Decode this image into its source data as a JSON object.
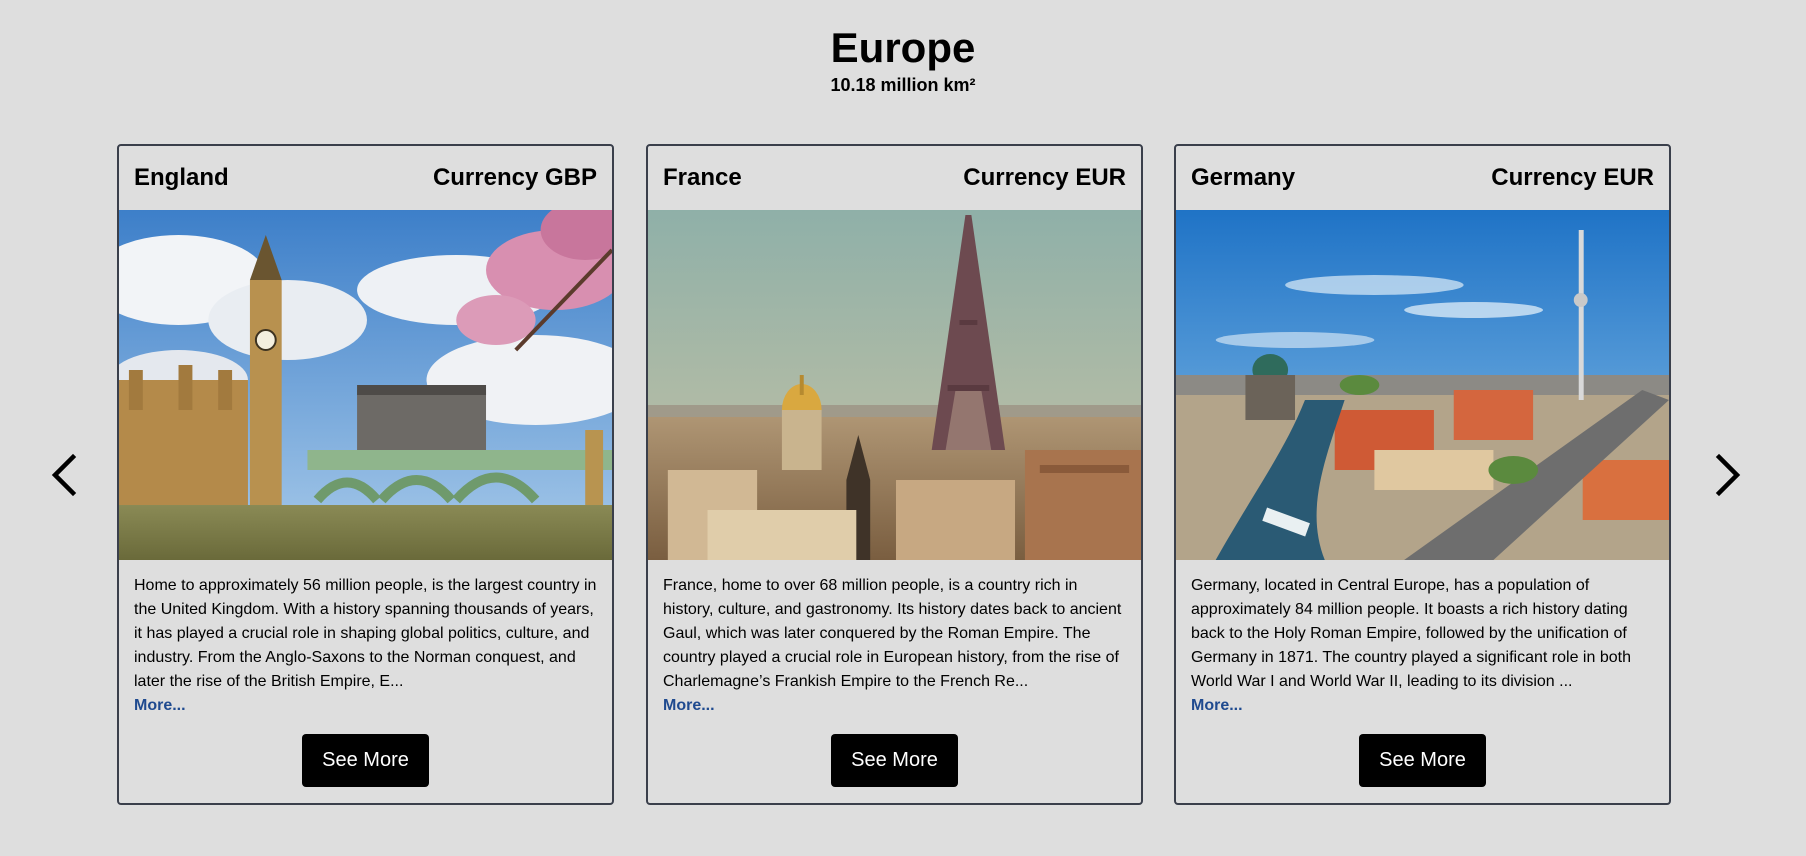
{
  "header": {
    "title": "Europe",
    "subtitle": "10.18 million km²"
  },
  "nav": {
    "prev_icon": "chevron-left-icon",
    "next_icon": "chevron-right-icon"
  },
  "cards": [
    {
      "country": "England",
      "currency": "Currency GBP",
      "image": "London: Big Ben, Palace of Westminster and Westminster Bridge with cherry blossoms",
      "description": "Home to approximately 56 million people, is the largest country in the United Kingdom. With a history spanning thousands of years, it has played a crucial role in shaping global politics, culture, and industry. From the Anglo-Saxons to the Norman conquest, and later the rise of the British Empire, E...",
      "more_label": "More...",
      "button_label": "See More"
    },
    {
      "country": "France",
      "currency": "Currency EUR",
      "image": "Paris skyline with the Eiffel Tower and Les Invalides dome",
      "description": "France, home to over 68 million people, is a country rich in history, culture, and gastronomy. Its history dates back to ancient Gaul, which was later conquered by the Roman Empire. The country played a crucial role in European history, from the rise of Charlemagne’s Frankish Empire to the French Re...",
      "more_label": "More...",
      "button_label": "See More"
    },
    {
      "country": "Germany",
      "currency": "Currency EUR",
      "image": "Berlin aerial view with the Spree river, Berlin Cathedral and TV tower",
      "description": "Germany, located in Central Europe, has a population of approximately 84 million people. It boasts a rich history dating back to the Holy Roman Empire, followed by the unification of Germany in 1871. The country played a significant role in both World War I and World War II, leading to its division ...",
      "more_label": "More...",
      "button_label": "See More"
    }
  ],
  "colors": {
    "background": "#dedede",
    "card_border": "#3a3f4b",
    "link": "#1f4a8f",
    "button_bg": "#000000",
    "button_text": "#ffffff"
  }
}
